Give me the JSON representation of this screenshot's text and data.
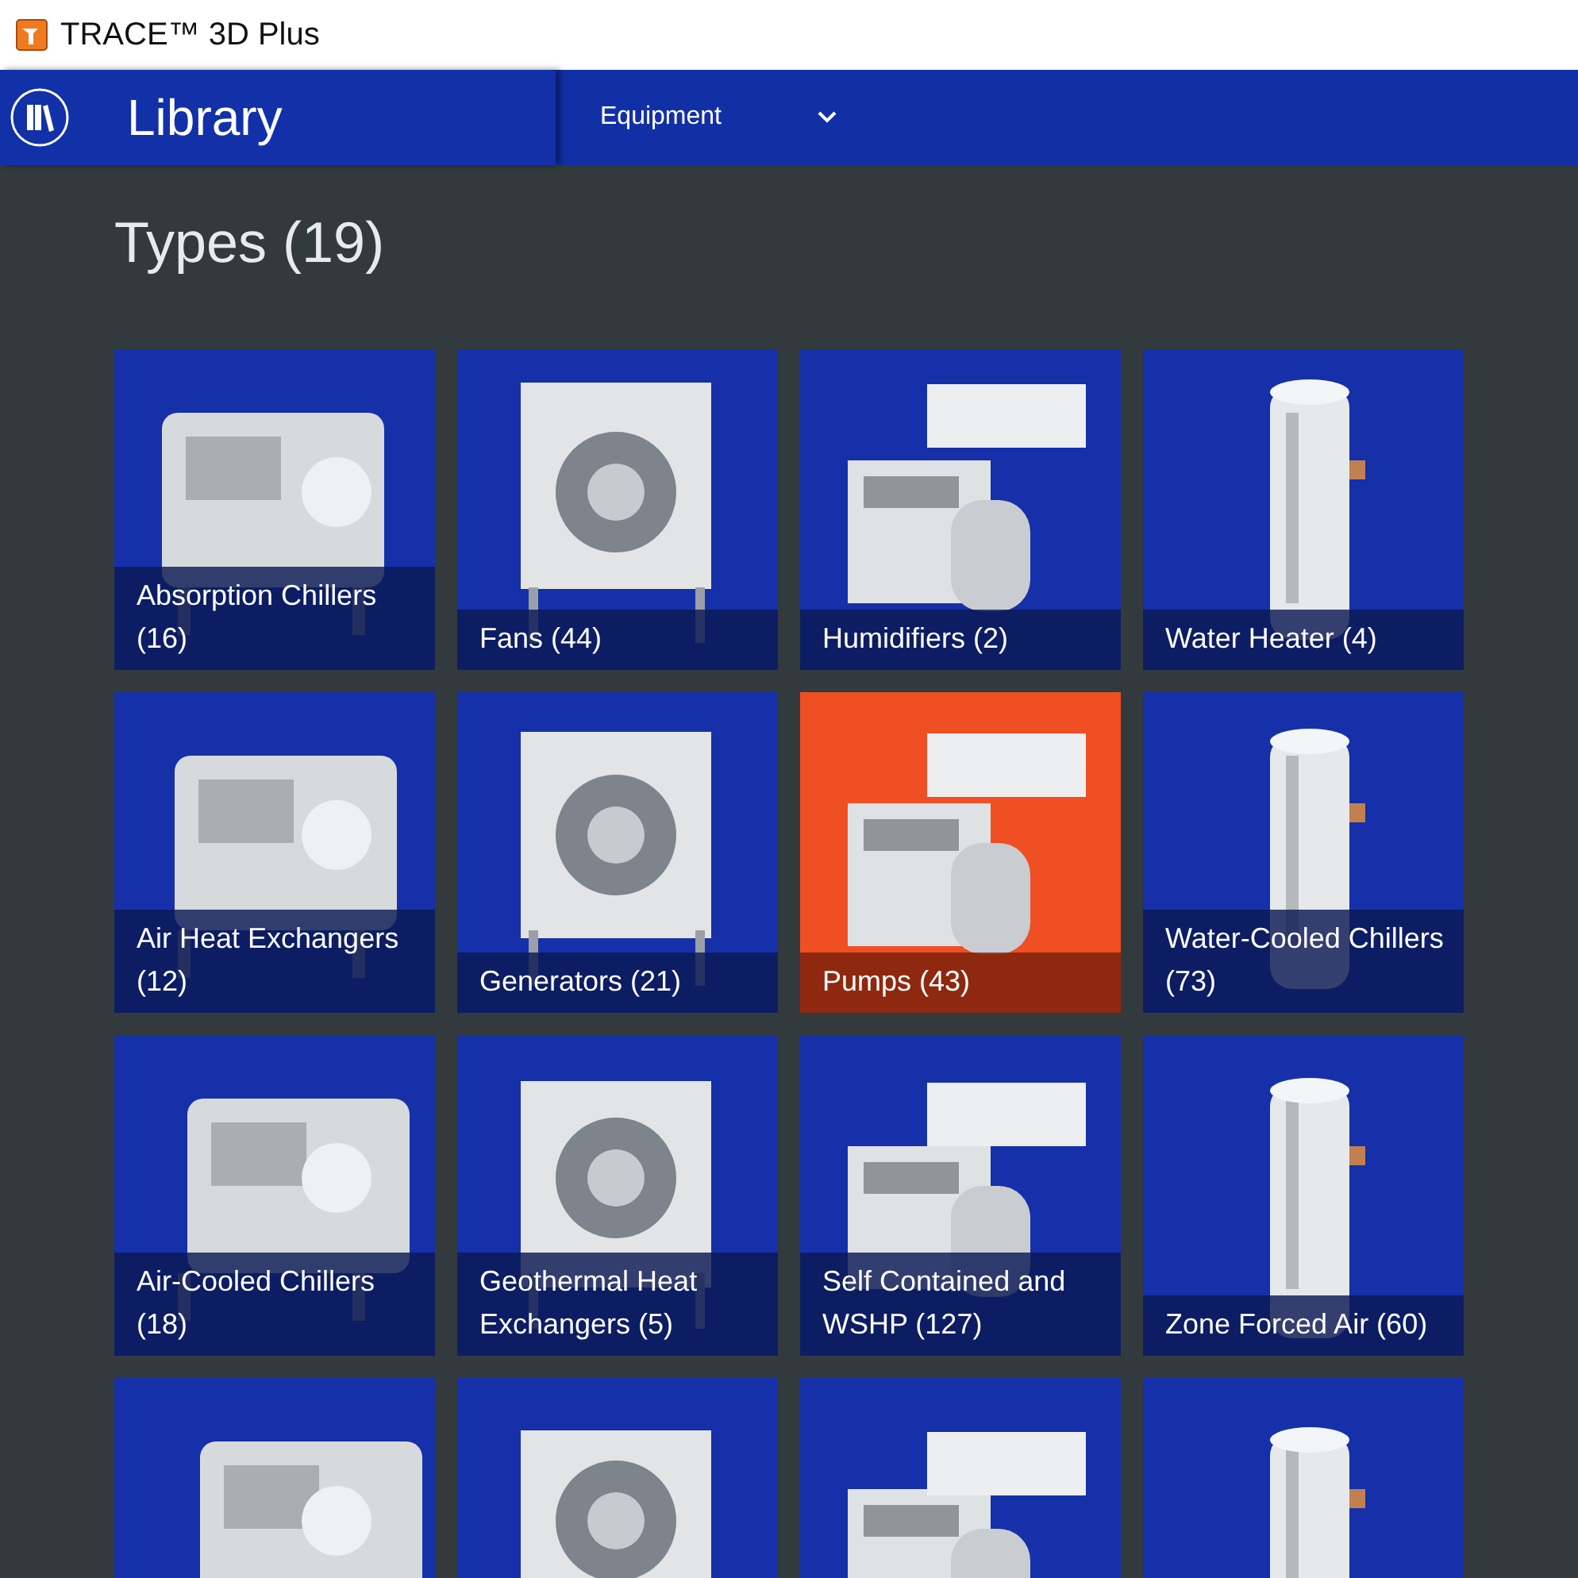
{
  "window": {
    "title": "TRACE™ 3D Plus"
  },
  "header": {
    "title": "Library",
    "dropdown": {
      "value": "Equipment"
    }
  },
  "heading": "Types (19)",
  "tiles": [
    {
      "label": "Absorption Chillers (16)",
      "selected": false
    },
    {
      "label": "Fans (44)",
      "selected": false
    },
    {
      "label": "Humidifiers (2)",
      "selected": false
    },
    {
      "label": "Water Heater (4)",
      "selected": false
    },
    {
      "label": "Air Heat Exchangers (12)",
      "selected": false
    },
    {
      "label": "Generators (21)",
      "selected": false
    },
    {
      "label": "Pumps (43)",
      "selected": true
    },
    {
      "label": "Water-Cooled Chillers (73)",
      "selected": false
    },
    {
      "label": "Air-Cooled Chillers (18)",
      "selected": false
    },
    {
      "label": "Geothermal Heat Exchangers (5)",
      "selected": false
    },
    {
      "label": "Self Contained and WSHP (127)",
      "selected": false
    },
    {
      "label": "Zone Forced Air (60)",
      "selected": false
    },
    {
      "selected": false
    },
    {
      "selected": false
    },
    {
      "selected": false
    },
    {
      "selected": false
    }
  ]
}
